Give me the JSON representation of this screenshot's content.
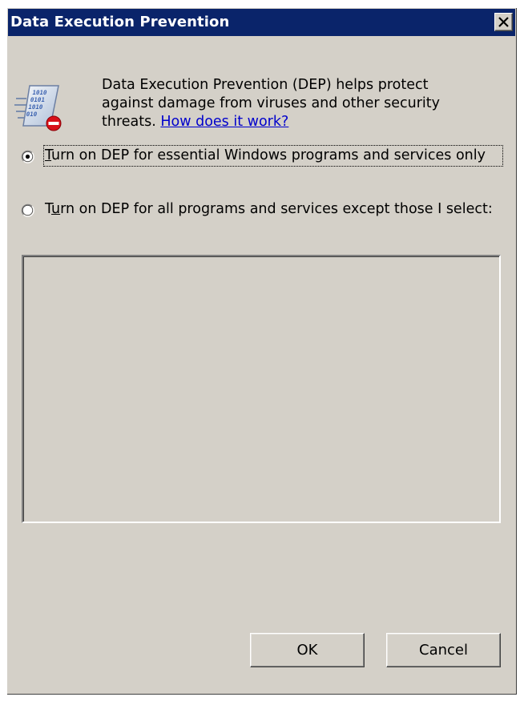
{
  "window": {
    "title": "Data Execution Prevention",
    "close_glyph": "close-icon"
  },
  "intro": {
    "text": "Data Execution Prevention (DEP) helps protect against damage from viruses and other security threats. ",
    "link": "How does it work?",
    "icon": "dep-shield-binary-icon"
  },
  "options": [
    {
      "prefix": "",
      "accel": "T",
      "rest": "urn on DEP for essential Windows programs and services only",
      "selected": true
    },
    {
      "prefix": "T",
      "accel": "u",
      "rest": "rn on DEP for all programs and services except those I select:",
      "selected": false
    }
  ],
  "exceptions_list": {
    "items": []
  },
  "buttons": {
    "ok": "OK",
    "cancel": "Cancel"
  },
  "colors": {
    "titlebar": "#0a246a",
    "face": "#d4d0c8",
    "link": "#0000cc"
  }
}
